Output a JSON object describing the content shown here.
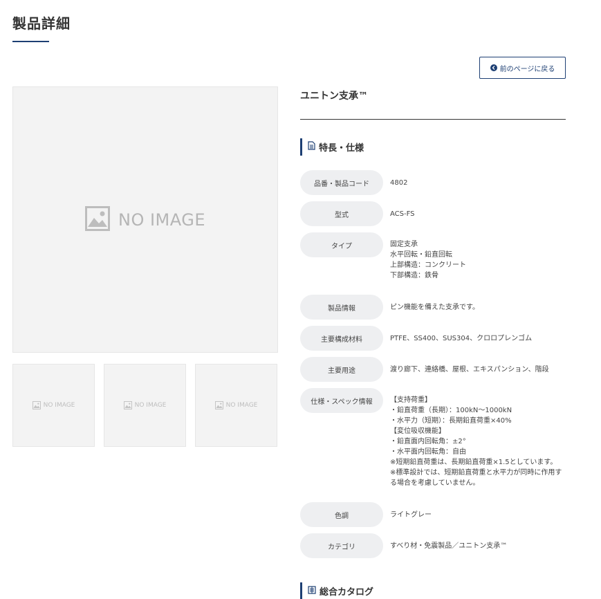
{
  "page": {
    "title": "製品詳細",
    "back_label": "前のページに戻る",
    "accent_color": "#1d3f73"
  },
  "images": {
    "main_placeholder": "NO IMAGE",
    "thumbnails": [
      "NO IMAGE",
      "NO IMAGE",
      "NO IMAGE"
    ]
  },
  "product": {
    "name": "ユニトン支承™"
  },
  "sections": {
    "features_title": "特長・仕様",
    "catalog_title": "総合カタログ"
  },
  "specs": [
    {
      "label": "品番・製品コード",
      "lines": [
        "4802"
      ]
    },
    {
      "label": "型式",
      "lines": [
        "ACS-FS"
      ]
    },
    {
      "label": "タイプ",
      "lines": [
        "固定支承",
        "水平回転・鉛直回転",
        "上部構造：コンクリート",
        "下部構造：鉄骨"
      ]
    },
    {
      "label": "製品情報",
      "lines": [
        "ピン機能を備えた支承です。"
      ]
    },
    {
      "label": "主要構成材料",
      "lines": [
        "PTFE、SS400、SUS304、クロロプレンゴム"
      ]
    },
    {
      "label": "主要用途",
      "lines": [
        "渡り廊下、連絡橋、屋根、エキスパンション、階段"
      ]
    },
    {
      "label": "仕様・スペック情報",
      "lines": [
        "【支持荷重】",
        "・鉛直荷重（長期）：100kN〜1000kN",
        "・水平力（短期）：長期鉛直荷重×40%",
        "【変位吸収機能】",
        "・鉛直面内回転角：±2°",
        "・水平面内回転角：自由",
        "※短期鉛直荷重は、長期鉛直荷重×1.5としています。",
        "※標準設計では、短期鉛直荷重と水平力が同時に作用する場合を考慮していません。"
      ]
    },
    {
      "label": "色調",
      "lines": [
        "ライトグレー"
      ]
    },
    {
      "label": "カテゴリ",
      "lines": [
        "すべり材・免震製品／ユニトン支承™"
      ]
    }
  ]
}
